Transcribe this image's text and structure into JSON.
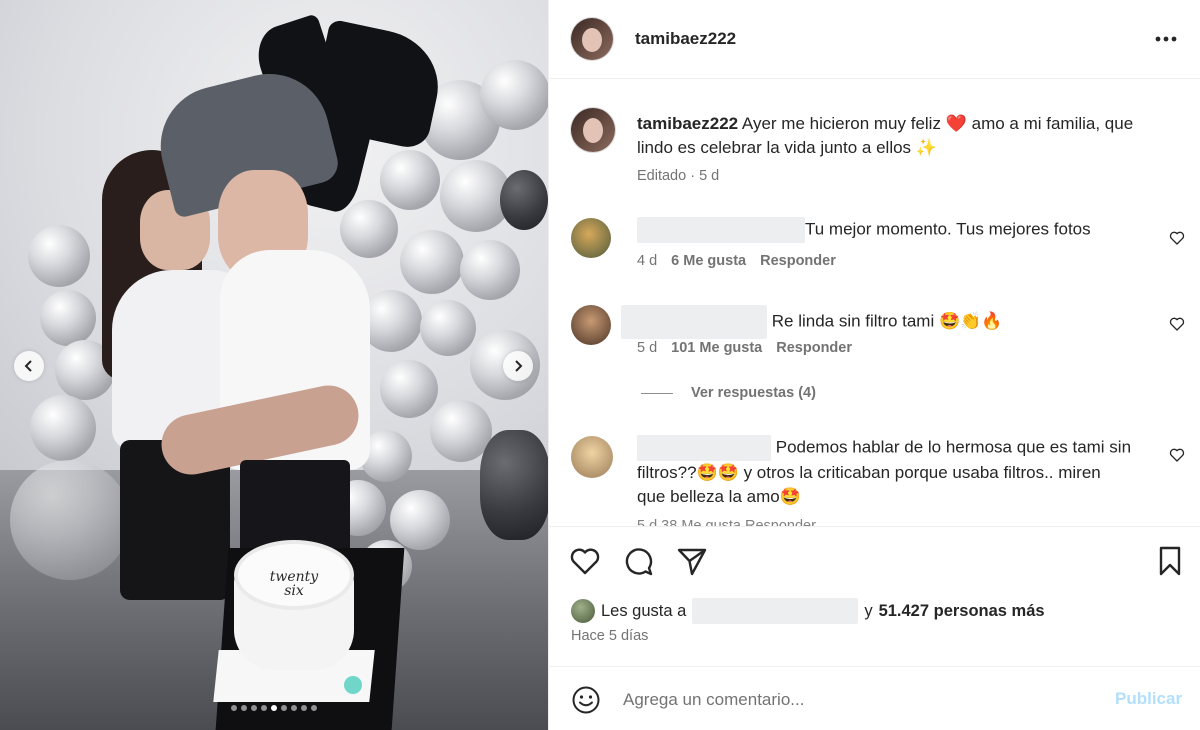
{
  "post": {
    "username": "tamibaez222",
    "caption_user": "tamibaez222",
    "caption_line1": "Ayer me hicieron muy feliz",
    "caption_heart": "❤️",
    "caption_line1b": "amo a mi familia, que",
    "caption_line2": "lindo es celebrar la vida junto a ellos",
    "caption_sparkle": "✨",
    "caption_meta": "Editado · 5 d",
    "cake_text": "twenty six"
  },
  "carousel": {
    "dot_count": 9,
    "active_index": 4
  },
  "comments": [
    {
      "text": "Tu mejor momento. Tus mejores fotos",
      "age": "4 d",
      "likes": "6 Me gusta",
      "reply": "Responder"
    },
    {
      "text": "Re linda sin filtro tami 🤩👏🔥",
      "age": "5 d",
      "likes": "101 Me gusta",
      "reply": "Responder",
      "view_replies": "Ver respuestas (4)"
    },
    {
      "text_line1": "Podemos hablar de lo hermosa que es tami sin",
      "text_line2": "filtros??🤩🤩 y otros la criticaban porque usaba filtros.. miren",
      "text_line3": "que belleza la amo🤩",
      "meta_partial": "5 d   38 Me gusta   Responder"
    }
  ],
  "likes": {
    "prefix": "Les gusta a",
    "connector": "y",
    "count": "51.427 personas más",
    "ago": "Hace 5 días"
  },
  "composer": {
    "placeholder": "Agrega un comentario...",
    "publish": "Publicar"
  },
  "icons": {
    "more": "more-horizontal-icon",
    "like": "heart-icon",
    "comment": "comment-icon",
    "share": "send-icon",
    "save": "bookmark-icon",
    "emoji": "emoji-icon",
    "prev": "chevron-left-icon",
    "next": "chevron-right-icon"
  },
  "colors": {
    "publish_disabled": "#b2dffc",
    "secondary_text": "#737373",
    "primary_text": "#262626"
  }
}
